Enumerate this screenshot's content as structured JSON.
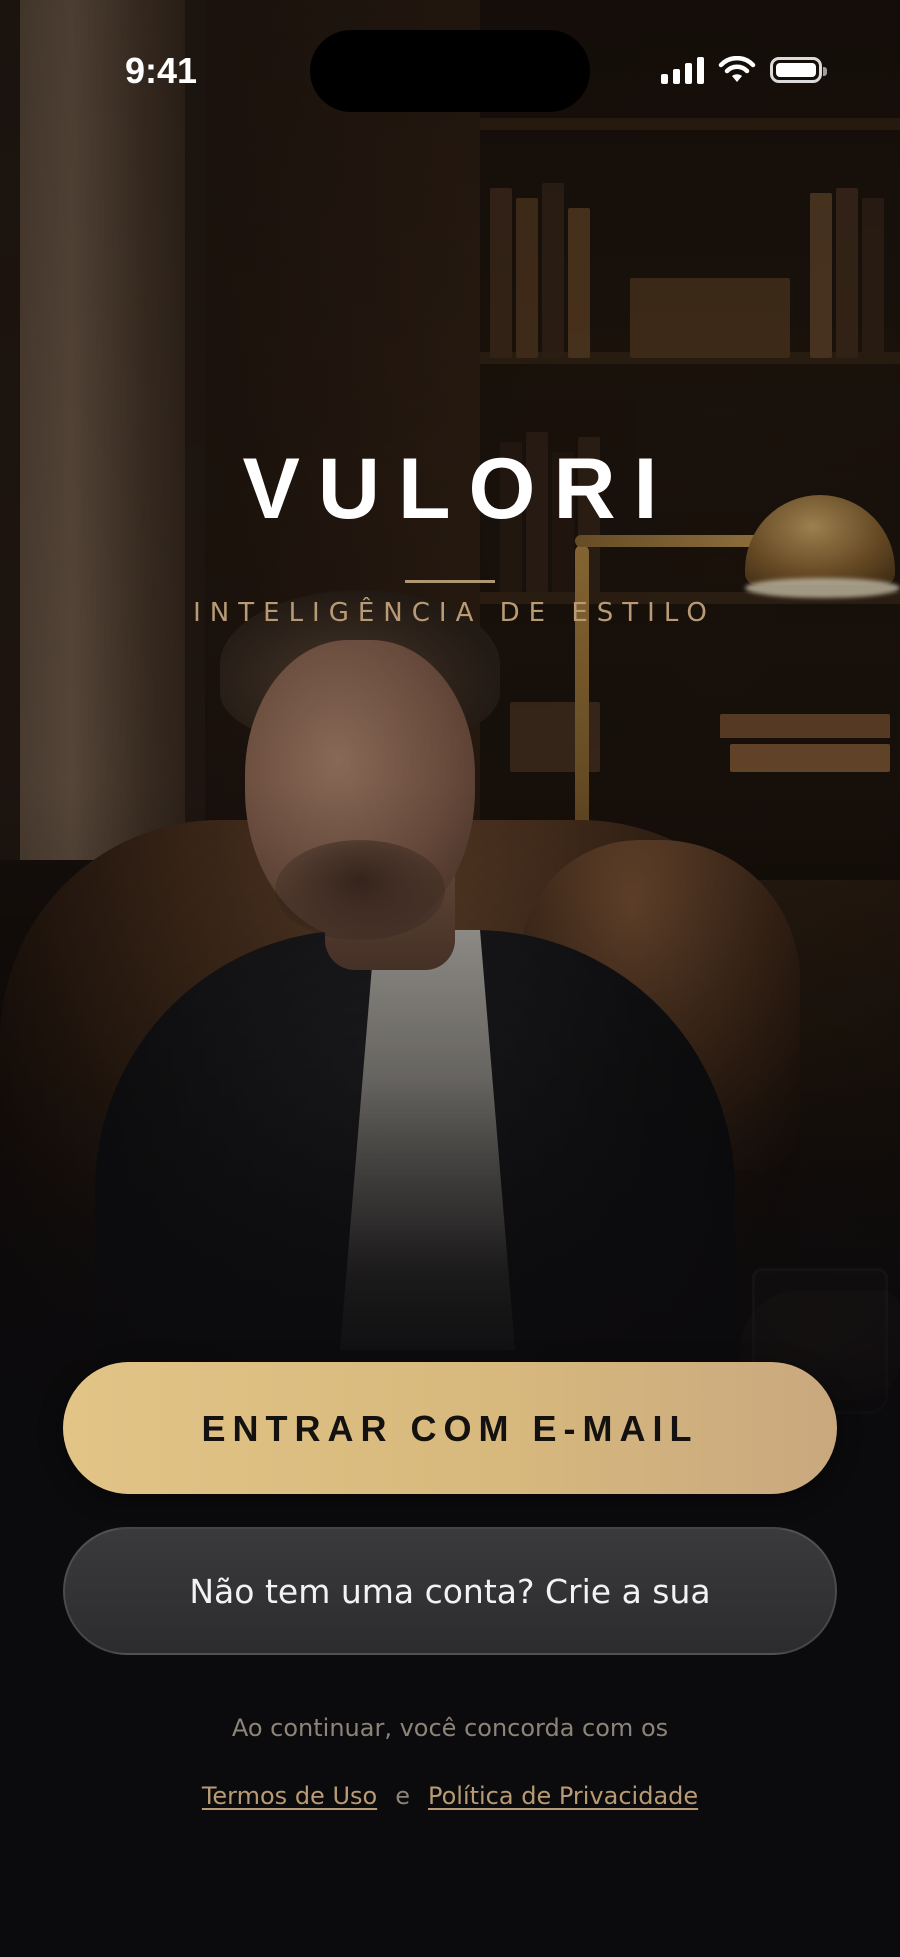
{
  "status_bar": {
    "time": "9:41",
    "icons": [
      "signal-icon",
      "wifi-icon",
      "battery-icon"
    ]
  },
  "brand": {
    "logo_text": "VULORI",
    "tagline": "INTELIGÊNCIA DE ESTILO"
  },
  "actions": {
    "primary_label": "ENTRAR COM E-MAIL",
    "secondary_label": "Não tem uma conta? Crie a sua"
  },
  "legal": {
    "intro": "Ao continuar, você concorda com os",
    "terms_label": "Termos de Uso",
    "conjunction": "e",
    "privacy_label": "Política de Privacidade"
  },
  "colors": {
    "accent_gold": "#d8b97d",
    "tagline": "#b89a74",
    "background": "#0b0a0c",
    "secondary_button": "#333335"
  }
}
